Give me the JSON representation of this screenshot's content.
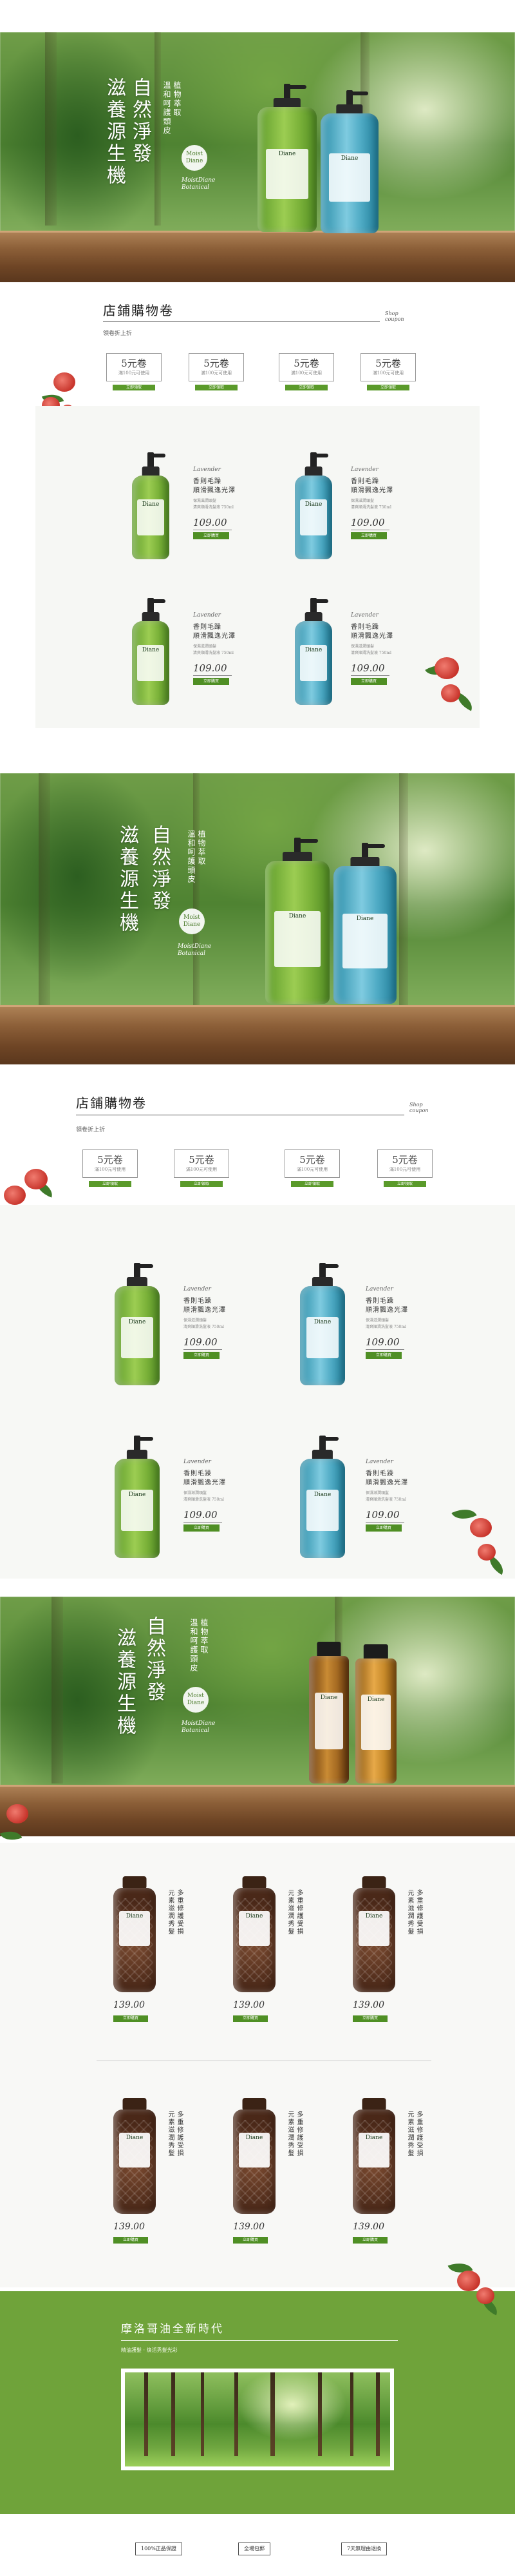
{
  "hero": {
    "title_vertical": [
      "自然淨發",
      "滋養源生機"
    ],
    "tagline_vertical": [
      "植物萃取",
      "溫和呵護頭皮"
    ],
    "seal": "Moist Diane",
    "english": "MoistDiane Botanical"
  },
  "coupon_section": {
    "title": "店鋪購物卷",
    "subtitle": "領卷折上折",
    "english_tag": [
      "Shop",
      "coupon"
    ],
    "coupons": [
      {
        "amount": "5元卷",
        "condition": "滿100元可使用",
        "button": "立即領取"
      },
      {
        "amount": "5元卷",
        "condition": "滿100元可使用",
        "button": "立即領取"
      },
      {
        "amount": "5元卷",
        "condition": "滿100元可使用",
        "button": "立即領取"
      },
      {
        "amount": "5元卷",
        "condition": "滿100元可使用",
        "button": "立即領取"
      }
    ]
  },
  "products": [
    {
      "english": "Lavender",
      "name1": "香則毛躁",
      "name2": "順滑飄逸光澤",
      "desc1": "保濕滋潤頭髮",
      "desc2": "清爽順滑洗髮液 750ml",
      "price": "109.00",
      "buy": "立即購買",
      "color": "green"
    },
    {
      "english": "Lavender",
      "name1": "香則毛躁",
      "name2": "順滑飄逸光澤",
      "desc1": "保濕滋潤頭髮",
      "desc2": "清爽順滑洗髮液 750ml",
      "price": "109.00",
      "buy": "立即購買",
      "color": "blue"
    },
    {
      "english": "Lavender",
      "name1": "香則毛躁",
      "name2": "順滑飄逸光澤",
      "desc1": "保濕滋潤頭髮",
      "desc2": "清爽順滑洗髮液 750ml",
      "price": "109.00",
      "buy": "立即購買",
      "color": "green"
    },
    {
      "english": "Lavender",
      "name1": "香則毛躁",
      "name2": "順滑飄逸光澤",
      "desc1": "保濕滋潤頭髮",
      "desc2": "清爽順滑洗髮液 750ml",
      "price": "109.00",
      "buy": "立即購買",
      "color": "blue"
    }
  ],
  "oil_products": [
    {
      "v1": "多重修護受損",
      "v2": "元素滋潤秀髮",
      "price": "139.00",
      "buy": "立即購買"
    },
    {
      "v1": "多重修護受損",
      "v2": "元素滋潤秀髮",
      "price": "139.00",
      "buy": "立即購買"
    },
    {
      "v1": "多重修護受損",
      "v2": "元素滋潤秀髮",
      "price": "139.00",
      "buy": "立即購買"
    },
    {
      "v1": "多重修護受損",
      "v2": "元素滋潤秀髮",
      "price": "139.00",
      "buy": "立即購買"
    },
    {
      "v1": "多重修護受損",
      "v2": "元素滋潤秀髮",
      "price": "139.00",
      "buy": "立即購買"
    },
    {
      "v1": "多重修護受損",
      "v2": "元素滋潤秀髮",
      "price": "139.00",
      "buy": "立即購買"
    }
  ],
  "footer": {
    "title": "摩洛哥油全新時代",
    "subtitle": "精油護髮 · 煥活秀髮光彩",
    "badges": [
      "100%正品保證",
      "全場包郵",
      "7天無理由退換"
    ]
  },
  "colors": {
    "accent": "#5a9a2a",
    "footer": "#6fa33a",
    "wood": "#8c5f38"
  }
}
